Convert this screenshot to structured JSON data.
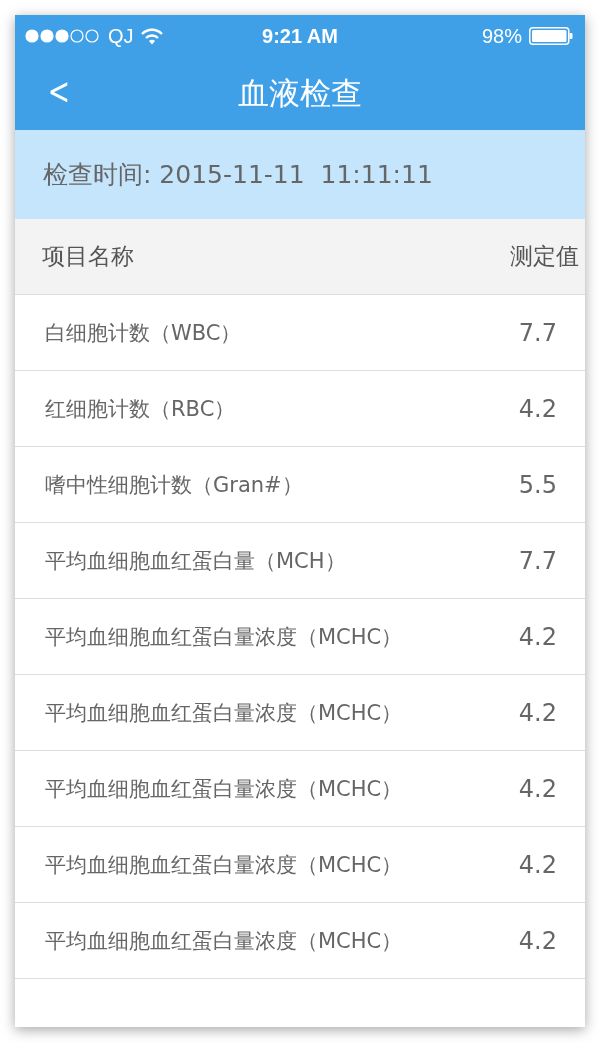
{
  "status_bar": {
    "carrier": "QJ",
    "time": "9:21 AM",
    "battery": "98%"
  },
  "nav": {
    "back": "<",
    "title": "血液检查"
  },
  "check_time": "检查时间: 2015-11-11  11:11:11",
  "table": {
    "columns": [
      "项目名称",
      "测定值"
    ],
    "rows": [
      {
        "name": "白细胞计数（WBC）",
        "value": "7.7"
      },
      {
        "name": "红细胞计数（RBC）",
        "value": "4.2"
      },
      {
        "name": "嗜中性细胞计数（Gran#）",
        "value": "5.5"
      },
      {
        "name": "平均血细胞血红蛋白量（MCH）",
        "value": "7.7"
      },
      {
        "name": "平均血细胞血红蛋白量浓度（MCHC）",
        "value": "4.2"
      },
      {
        "name": "平均血细胞血红蛋白量浓度（MCHC）",
        "value": "4.2"
      },
      {
        "name": "平均血细胞血红蛋白量浓度（MCHC）",
        "value": "4.2"
      },
      {
        "name": "平均血细胞血红蛋白量浓度（MCHC）",
        "value": "4.2"
      },
      {
        "name": "平均血细胞血红蛋白量浓度（MCHC）",
        "value": "4.2"
      }
    ]
  }
}
